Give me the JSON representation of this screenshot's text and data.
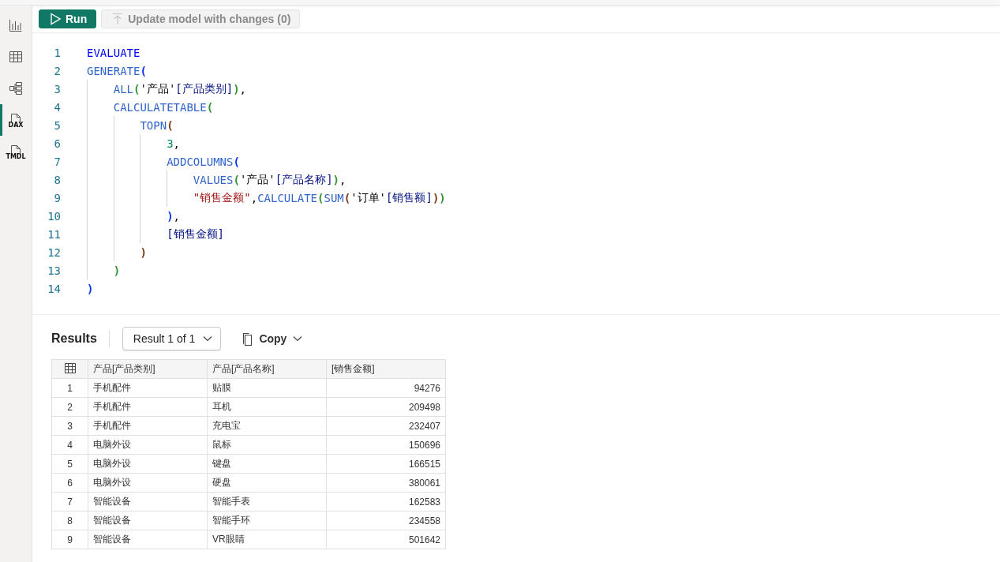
{
  "sidebar": {
    "items": [
      {
        "kind": "chart",
        "selected": false
      },
      {
        "kind": "table",
        "selected": false
      },
      {
        "kind": "model",
        "selected": false
      },
      {
        "kind": "file",
        "label": "DAX",
        "selected": true
      },
      {
        "kind": "file",
        "label": "TMDL",
        "selected": false
      }
    ]
  },
  "toolbar": {
    "run_button": {
      "label": "Run"
    },
    "update_button": {
      "label": "Update model with changes (0)",
      "disabled": true
    }
  },
  "editor": {
    "lines": [
      {
        "number": "1",
        "tokens": [
          {
            "kind": "keyword",
            "text": "EVALUATE"
          }
        ]
      },
      {
        "number": "2",
        "tokens": [
          {
            "kind": "function",
            "text": "GENERATE"
          },
          {
            "kind": "paren",
            "text": "(",
            "color": "#0431fa"
          }
        ]
      },
      {
        "number": "3",
        "tokens": [
          {
            "kind": "function",
            "text": "    ALL"
          },
          {
            "kind": "paren",
            "text": "(",
            "color": "#319331"
          },
          {
            "kind": "table",
            "text": "'产品'"
          },
          {
            "kind": "column",
            "text": "[产品类别]"
          },
          {
            "kind": "paren",
            "text": ")",
            "color": "#319331"
          },
          {
            "kind": "punct",
            "text": ","
          }
        ]
      },
      {
        "number": "4",
        "tokens": [
          {
            "kind": "function",
            "text": "    CALCULATETABLE"
          },
          {
            "kind": "paren",
            "text": "(",
            "color": "#319331"
          }
        ]
      },
      {
        "number": "5",
        "tokens": [
          {
            "kind": "function",
            "text": "        TOPN"
          },
          {
            "kind": "paren",
            "text": "(",
            "color": "#7b3814"
          }
        ]
      },
      {
        "number": "6",
        "tokens": [
          {
            "kind": "number",
            "text": "            3"
          },
          {
            "kind": "punct",
            "text": ","
          }
        ]
      },
      {
        "number": "7",
        "tokens": [
          {
            "kind": "function",
            "text": "            ADDCOLUMNS"
          },
          {
            "kind": "paren",
            "text": "(",
            "color": "#0431fa"
          }
        ]
      },
      {
        "number": "8",
        "tokens": [
          {
            "kind": "function",
            "text": "                VALUES"
          },
          {
            "kind": "paren",
            "text": "(",
            "color": "#319331"
          },
          {
            "kind": "table",
            "text": "'产品'"
          },
          {
            "kind": "column",
            "text": "[产品名称]"
          },
          {
            "kind": "paren",
            "text": ")",
            "color": "#319331"
          },
          {
            "kind": "punct",
            "text": ","
          }
        ]
      },
      {
        "number": "9",
        "tokens": [
          {
            "kind": "string",
            "text": "                \"销售金额\""
          },
          {
            "kind": "punct",
            "text": ","
          },
          {
            "kind": "function",
            "text": "CALCULATE"
          },
          {
            "kind": "paren",
            "text": "(",
            "color": "#319331"
          },
          {
            "kind": "function",
            "text": "SUM"
          },
          {
            "kind": "paren",
            "text": "(",
            "color": "#7b3814"
          },
          {
            "kind": "table",
            "text": "'订单'"
          },
          {
            "kind": "column",
            "text": "[销售额]"
          },
          {
            "kind": "paren",
            "text": ")",
            "color": "#7b3814"
          },
          {
            "kind": "paren",
            "text": ")",
            "color": "#319331"
          }
        ]
      },
      {
        "number": "10",
        "tokens": [
          {
            "kind": "paren",
            "text": "            )",
            "color": "#0431fa"
          },
          {
            "kind": "punct",
            "text": ","
          }
        ]
      },
      {
        "number": "11",
        "tokens": [
          {
            "kind": "column",
            "text": "            [销售金额]"
          }
        ]
      },
      {
        "number": "12",
        "tokens": [
          {
            "kind": "paren",
            "text": "        )",
            "color": "#7b3814"
          }
        ]
      },
      {
        "number": "13",
        "tokens": [
          {
            "kind": "paren",
            "text": "    )",
            "color": "#319331"
          }
        ]
      },
      {
        "number": "14",
        "tokens": [
          {
            "kind": "paren",
            "text": ")",
            "color": "#0431fa"
          }
        ]
      }
    ]
  },
  "results": {
    "title": "Results",
    "result_picker": "Result 1 of 1",
    "copy_button": "Copy",
    "table": {
      "columns": [
        "产品[产品类别]",
        "产品[产品名称]",
        "[销售金额]"
      ],
      "rows": [
        {
          "index": "1",
          "cells": [
            "手机配件",
            "贴膜",
            "94276"
          ]
        },
        {
          "index": "2",
          "cells": [
            "手机配件",
            "耳机",
            "209498"
          ]
        },
        {
          "index": "3",
          "cells": [
            "手机配件",
            "充电宝",
            "232407"
          ]
        },
        {
          "index": "4",
          "cells": [
            "电脑外设",
            "鼠标",
            "150696"
          ]
        },
        {
          "index": "5",
          "cells": [
            "电脑外设",
            "键盘",
            "166515"
          ]
        },
        {
          "index": "6",
          "cells": [
            "电脑外设",
            "硬盘",
            "380061"
          ]
        },
        {
          "index": "7",
          "cells": [
            "智能设备",
            "智能手表",
            "162583"
          ]
        },
        {
          "index": "8",
          "cells": [
            "智能设备",
            "智能手环",
            "234558"
          ]
        },
        {
          "index": "9",
          "cells": [
            "智能设备",
            "VR眼睛",
            "501642"
          ]
        }
      ]
    }
  }
}
